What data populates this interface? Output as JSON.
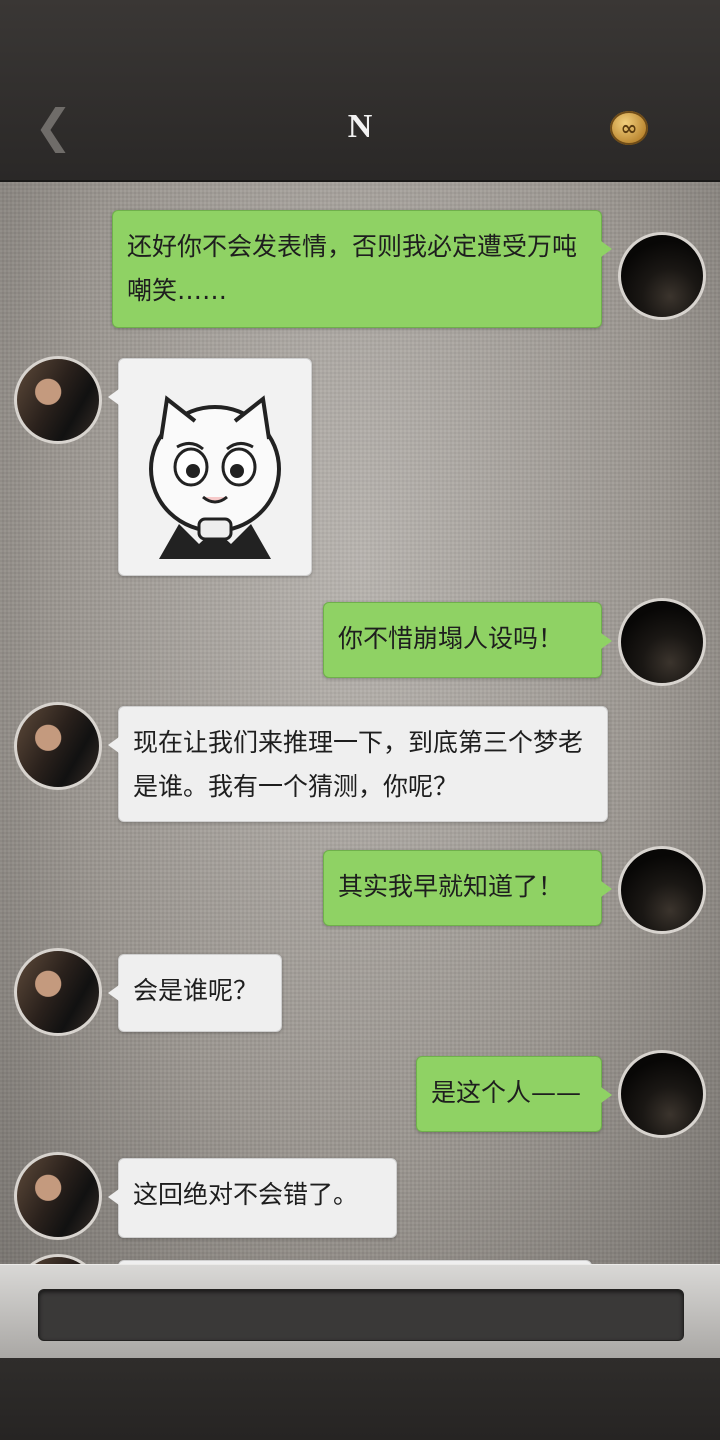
{
  "header": {
    "back_icon": "chevron-left-icon",
    "title": "N",
    "menu_icon": "infinity-badge-icon",
    "menu_glyph": "∞"
  },
  "messages": [
    {
      "side": "out",
      "text": "还好你不会发表情，否则我必定遭受万吨嘲笑……"
    },
    {
      "side": "in",
      "type": "sticker",
      "sticker_icon": "crying-cat-sticker-icon"
    },
    {
      "side": "out",
      "text": "你不惜崩塌人设吗！"
    },
    {
      "side": "in",
      "text": "现在让我们来推理一下，到底第三个梦老是谁。我有一个猜测，你呢？"
    },
    {
      "side": "out",
      "text": "其实我早就知道了！"
    },
    {
      "side": "in",
      "text": "会是谁呢？"
    },
    {
      "side": "out",
      "text": "是这个人——"
    },
    {
      "side": "in",
      "text": "这回绝对不会错了。"
    }
  ],
  "composer": {
    "placeholder": ""
  },
  "colors": {
    "outgoing_bubble": "#8fd264",
    "incoming_bubble": "#efefef",
    "header_bg": "#2f2d2b"
  }
}
